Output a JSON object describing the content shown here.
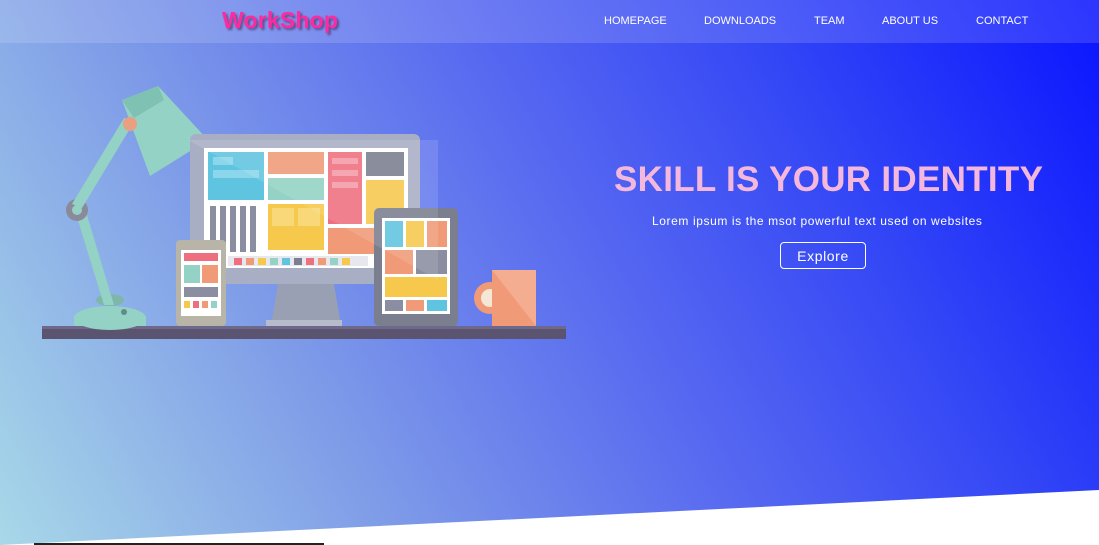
{
  "brand": {
    "logo_text": "WorkShop"
  },
  "nav": {
    "items": [
      {
        "label": "HOMEPAGE"
      },
      {
        "label": "DOWNLOADS"
      },
      {
        "label": "TEAM"
      },
      {
        "label": "ABOUT US"
      },
      {
        "label": "CONTACT"
      }
    ]
  },
  "hero": {
    "title": "SKILL IS YOUR IDENTITY",
    "subtitle": "Lorem ipsum is the msot powerful text used on websites",
    "button_label": "Explore"
  },
  "colors": {
    "logo": "#ff2aa0",
    "title": "#f4b8dc",
    "gradient_start": "#a8d8e8",
    "gradient_end": "#0a14ff"
  },
  "illustration": {
    "icon": "desk-workspace-illustration"
  }
}
